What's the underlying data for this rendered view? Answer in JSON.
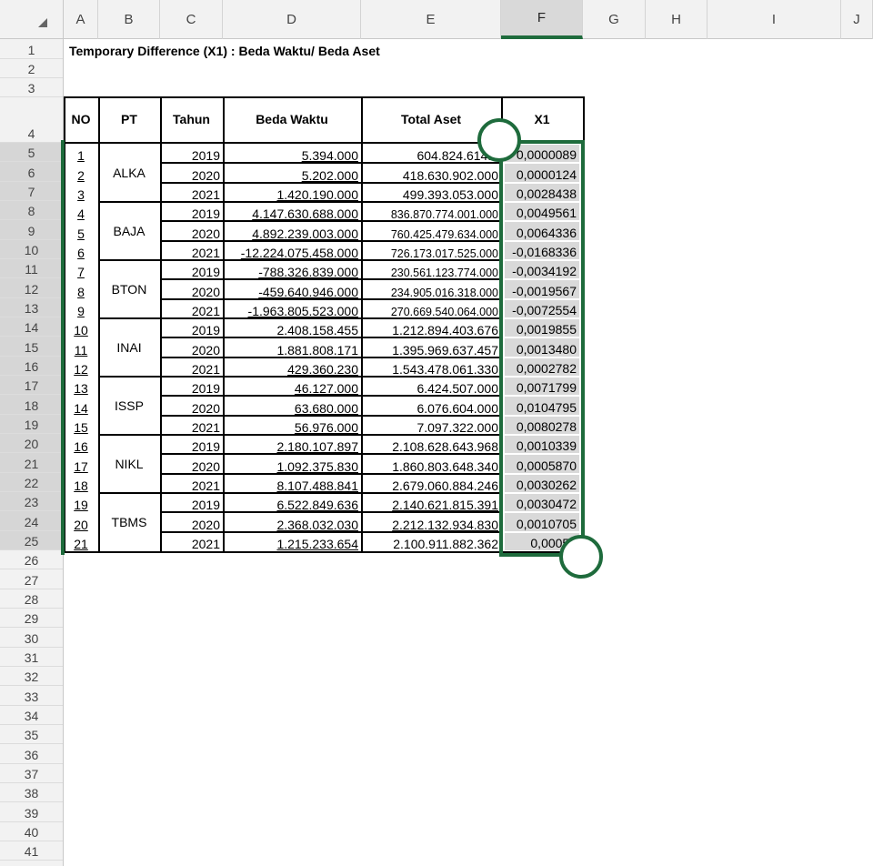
{
  "columns": [
    "A",
    "B",
    "C",
    "D",
    "E",
    "F",
    "G",
    "H",
    "I",
    "J"
  ],
  "selected_column": "F",
  "rows": [
    "1",
    "2",
    "3",
    "4",
    "5",
    "6",
    "7",
    "8",
    "9",
    "10",
    "11",
    "12",
    "13",
    "14",
    "15",
    "16",
    "17",
    "18",
    "19",
    "20",
    "21",
    "22",
    "23",
    "24",
    "25",
    "26",
    "27",
    "28",
    "29",
    "30",
    "31",
    "32",
    "33",
    "34",
    "35",
    "36",
    "37",
    "38",
    "39",
    "40",
    "41"
  ],
  "title": "Temporary Difference (X1) : Beda Waktu/ Beda Aset",
  "headers": {
    "no": "NO",
    "pt": "PT",
    "tahun": "Tahun",
    "beda": "Beda Waktu",
    "total": "Total Aset",
    "x1": "X1"
  },
  "companies": [
    "ALKA",
    "BAJA",
    "BTON",
    "INAI",
    "ISSP",
    "NIKL",
    "TBMS"
  ],
  "data": [
    {
      "no": "1",
      "tahun": "2019",
      "beda": "5.394.000",
      "total": "604.824.614.0",
      "x1": "0,0000089"
    },
    {
      "no": "2",
      "tahun": "2020",
      "beda": "5.202.000",
      "total": "418.630.902.000",
      "x1": "0,0000124"
    },
    {
      "no": "3",
      "tahun": "2021",
      "beda": "1.420.190.000",
      "total": "499.393.053.000",
      "x1": "0,0028438"
    },
    {
      "no": "4",
      "tahun": "2019",
      "beda": "4.147.630.688.000",
      "total": "836.870.774.001.000",
      "x1": "0,0049561"
    },
    {
      "no": "5",
      "tahun": "2020",
      "beda": "4.892.239.003.000",
      "total": "760.425.479.634.000",
      "x1": "0,0064336"
    },
    {
      "no": "6",
      "tahun": "2021",
      "beda": "-12.224.075.458.000",
      "total": "726.173.017.525.000",
      "x1": "-0,0168336"
    },
    {
      "no": "7",
      "tahun": "2019",
      "beda": "-788.326.839.000",
      "total": "230.561.123.774.000",
      "x1": "-0,0034192"
    },
    {
      "no": "8",
      "tahun": "2020",
      "beda": "-459.640.946.000",
      "total": "234.905.016.318.000",
      "x1": "-0,0019567"
    },
    {
      "no": "9",
      "tahun": "2021",
      "beda": "-1.963.805.523.000",
      "total": "270.669.540.064.000",
      "x1": "-0,0072554"
    },
    {
      "no": "10",
      "tahun": "2019",
      "beda": "2.408.158.455",
      "total": "1.212.894.403.676",
      "x1": "0,0019855"
    },
    {
      "no": "11",
      "tahun": "2020",
      "beda": "1.881.808.171",
      "total": "1.395.969.637.457",
      "x1": "0,0013480"
    },
    {
      "no": "12",
      "tahun": "2021",
      "beda": "429.360.230",
      "total": "1.543.478.061.330",
      "x1": "0,0002782"
    },
    {
      "no": "13",
      "tahun": "2019",
      "beda": "46.127.000",
      "total": "6.424.507.000",
      "x1": "0,0071799"
    },
    {
      "no": "14",
      "tahun": "2020",
      "beda": "63.680.000",
      "total": "6.076.604.000",
      "x1": "0,0104795"
    },
    {
      "no": "15",
      "tahun": "2021",
      "beda": "56.976.000",
      "total": "7.097.322.000",
      "x1": "0,0080278"
    },
    {
      "no": "16",
      "tahun": "2019",
      "beda": "2.180.107.897",
      "total": "2.108.628.643.968",
      "x1": "0,0010339"
    },
    {
      "no": "17",
      "tahun": "2020",
      "beda": "1.092.375.830",
      "total": "1.860.803.648.340",
      "x1": "0,0005870"
    },
    {
      "no": "18",
      "tahun": "2021",
      "beda": "8.107.488.841",
      "total": "2.679.060.884.246",
      "x1": "0,0030262"
    },
    {
      "no": "19",
      "tahun": "2019",
      "beda": "6.522.849.636",
      "total": "2.140.621.815.391",
      "x1": "0,0030472"
    },
    {
      "no": "20",
      "tahun": "2020",
      "beda": "2.368.032.030",
      "total": "2.212.132.934.830",
      "x1": "0,0010705"
    },
    {
      "no": "21",
      "tahun": "2021",
      "beda": "1.215.233.654",
      "total": "2.100.911.882.362",
      "x1": "0,00057"
    }
  ],
  "accent_color": "#1e6b3c"
}
